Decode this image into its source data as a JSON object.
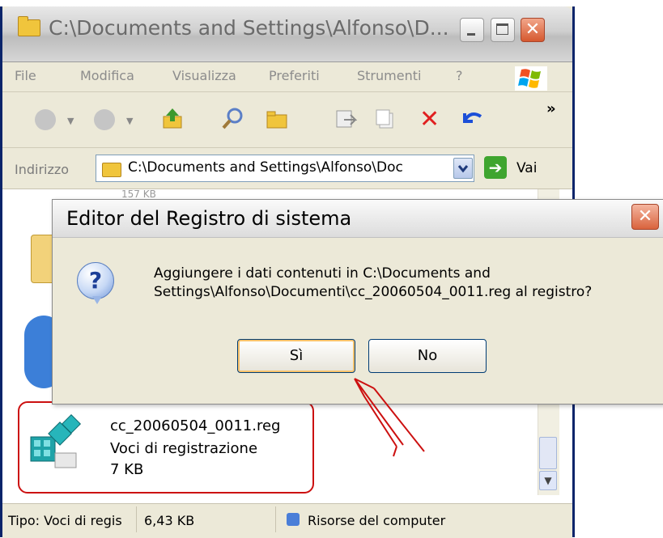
{
  "explorer": {
    "title": "C:\\Documents and Settings\\Alfonso\\D...",
    "menu": [
      "File",
      "Modifica",
      "Visualizza",
      "Preferiti",
      "Strumenti",
      "?"
    ],
    "toolbar_overflow": "»",
    "address_label": "Indirizzo",
    "address_value": "C:\\Documents and Settings\\Alfonso\\Doc",
    "go_label": "Vai",
    "partial_size_text": "157 KB"
  },
  "file": {
    "name": "cc_20060504_0011.reg",
    "type": "Voci di registrazione",
    "size": "7 KB"
  },
  "statusbar": {
    "type_text": "Tipo: Voci di regis",
    "size_text": "6,43 KB",
    "location_text": "Risorse del computer"
  },
  "dialog": {
    "title": "Editor del Registro di sistema",
    "message_line1": "Aggiungere i dati contenuti in C:\\Documents and",
    "message_line2": "Settings\\Alfonso\\Documenti\\cc_20060504_0011.reg al registro?",
    "yes_label": "Sì",
    "no_label": "No"
  },
  "colors": {
    "highlight": "#cc1010",
    "dialog_bg": "#ece9d8",
    "button_border": "#003c74"
  }
}
